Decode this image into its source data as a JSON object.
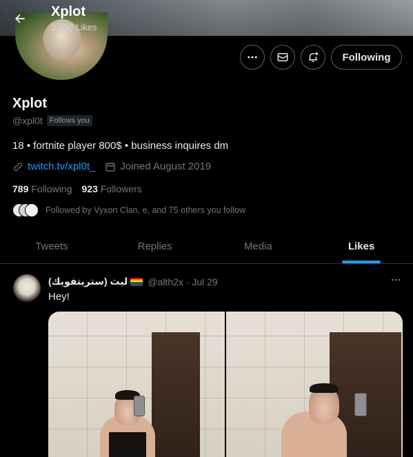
{
  "header": {
    "name": "Xplot",
    "likes": "2,250 Likes"
  },
  "actions": {
    "more_icon": "ellipsis-icon",
    "message_icon": "mail-icon",
    "notify_icon": "bell-plus-icon",
    "follow_label": "Following"
  },
  "profile": {
    "name": "Xplot",
    "handle": "@xpl0t",
    "follows_you": "Follows you",
    "bio": "18 • fortnite player  800$ • business inquires dm",
    "link": "twitch.tv/xpl0t_",
    "joined": "Joined August 2019",
    "following_count": "789",
    "following_label": "Following",
    "followers_count": "923",
    "followers_label": "Followers",
    "followed_by": "Followed by Vyxon Clan, e, and 75 others you follow"
  },
  "tabs": [
    {
      "label": "Tweets",
      "active": false
    },
    {
      "label": "Replies",
      "active": false
    },
    {
      "label": "Media",
      "active": false
    },
    {
      "label": "Likes",
      "active": true
    }
  ],
  "tweet": {
    "author": "ليث (ستريتفويك)",
    "handle_date": "@alth2x · Jul 29",
    "text": "Hey!"
  },
  "colors": {
    "accent": "#1d9bf0",
    "muted": "#71767b",
    "text": "#e7e9ea",
    "background": "#000000"
  }
}
